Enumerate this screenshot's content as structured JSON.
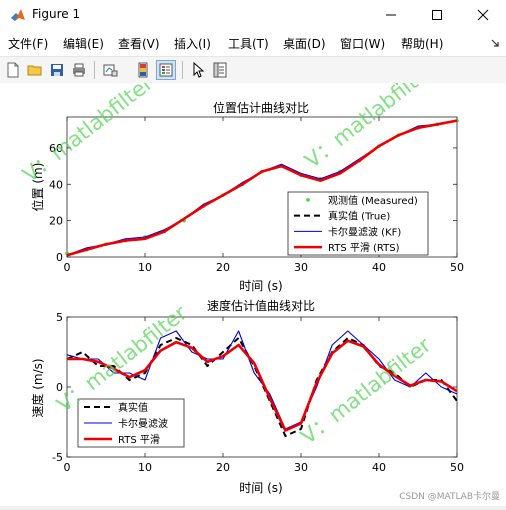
{
  "window": {
    "title": "Figure 1"
  },
  "menu": [
    "文件(F)",
    "编辑(E)",
    "查看(V)",
    "插入(I)",
    "工具(T)",
    "桌面(D)",
    "窗口(W)",
    "帮助(H)"
  ],
  "watermark": {
    "text": "V：matlabfilter",
    "color": "#5cd65c"
  },
  "credit": "CSDN @MATLAB卡尔曼",
  "chart_data": [
    {
      "type": "line",
      "title": "位置估计曲线对比",
      "xlabel": "时间 (s)",
      "ylabel": "位置 (m)",
      "xlim": [
        0,
        50
      ],
      "ylim": [
        0,
        77
      ],
      "xticks": [
        0,
        10,
        20,
        30,
        40,
        50
      ],
      "yticks": [
        0,
        20,
        40,
        60
      ],
      "legend_position": "bottom-right",
      "x": [
        0,
        2.5,
        5,
        7.5,
        10,
        12.5,
        15,
        17.5,
        20,
        22.5,
        25,
        27.5,
        30,
        32.5,
        35,
        37.5,
        40,
        42.5,
        45,
        47.5,
        50
      ],
      "series": [
        {
          "name": "观测值 (Measured)",
          "style": "markers",
          "color": "#3dd63d",
          "values": [
            2,
            4,
            7,
            9,
            11,
            14,
            20,
            28,
            34,
            40,
            47,
            50,
            45,
            43,
            47,
            53,
            61,
            67,
            71,
            73,
            75
          ]
        },
        {
          "name": "真实值 (True)",
          "style": "dashed",
          "color": "#000000",
          "values": [
            1,
            4,
            7,
            9,
            10,
            14,
            21,
            28,
            34,
            40,
            47,
            50,
            45,
            42,
            46,
            53,
            61,
            67,
            71,
            73,
            75
          ]
        },
        {
          "name": "卡尔曼滤波 (KF)",
          "style": "solid",
          "color": "#0000dd",
          "values": [
            1,
            5,
            7,
            10,
            11,
            15,
            21,
            29,
            34,
            41,
            47,
            51,
            46,
            43,
            47,
            54,
            61,
            67,
            72,
            73,
            75
          ]
        },
        {
          "name": "RTS 平滑 (RTS)",
          "style": "thick",
          "color": "#ee0000",
          "values": [
            1,
            4,
            7,
            9,
            10,
            14,
            21,
            28,
            34,
            40,
            47,
            50,
            45,
            42,
            46,
            53,
            61,
            67,
            71,
            73,
            75
          ]
        }
      ]
    },
    {
      "type": "line",
      "title": "速度估计值曲线对比",
      "xlabel": "时间 (s)",
      "ylabel": "速度 (m/s)",
      "xlim": [
        0,
        50
      ],
      "ylim": [
        -5,
        5
      ],
      "xticks": [
        0,
        10,
        20,
        30,
        40,
        50
      ],
      "yticks": [
        -5,
        0,
        5
      ],
      "legend_position": "bottom-left",
      "x": [
        0,
        2,
        4,
        6,
        8,
        10,
        12,
        14,
        16,
        18,
        20,
        22,
        24,
        26,
        28,
        30,
        32,
        34,
        36,
        38,
        40,
        42,
        44,
        46,
        48,
        50
      ],
      "series": [
        {
          "name": "真实值",
          "style": "dashed",
          "color": "#000000",
          "values": [
            2.0,
            2.5,
            1.5,
            1.5,
            0.5,
            1.0,
            3.0,
            3.5,
            3.0,
            1.5,
            2.5,
            3.5,
            1.5,
            -1.0,
            -3.5,
            -3.0,
            0.5,
            2.5,
            3.5,
            3.0,
            1.5,
            1.0,
            0.0,
            0.5,
            0.5,
            -1.0
          ]
        },
        {
          "name": "卡尔曼滤波",
          "style": "solid",
          "color": "#0000dd",
          "values": [
            2.3,
            2.0,
            2.0,
            1.0,
            1.0,
            0.5,
            3.5,
            4.0,
            2.5,
            2.0,
            2.0,
            4.0,
            1.0,
            -0.5,
            -3.0,
            -2.5,
            0.0,
            3.0,
            4.0,
            3.0,
            2.0,
            0.5,
            0.0,
            1.0,
            0.0,
            -0.5
          ]
        },
        {
          "name": "RTS 平滑",
          "style": "thick",
          "color": "#ee0000",
          "values": [
            2.0,
            2.0,
            1.8,
            1.3,
            0.7,
            1.2,
            2.6,
            3.2,
            2.8,
            1.8,
            2.2,
            3.0,
            1.7,
            -0.8,
            -3.1,
            -2.6,
            0.3,
            2.4,
            3.3,
            2.9,
            1.6,
            0.8,
            0.1,
            0.5,
            0.4,
            -0.3
          ]
        }
      ]
    }
  ]
}
